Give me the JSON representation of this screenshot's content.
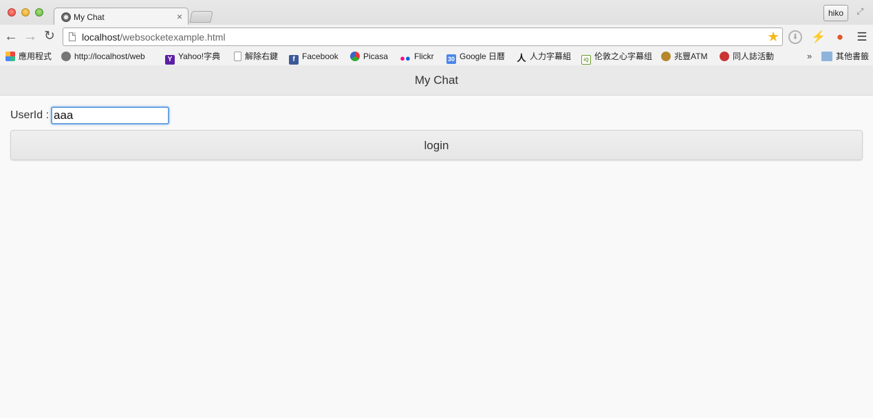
{
  "browser": {
    "tab_title": "My Chat",
    "tab_close": "×",
    "profile_name": "hiko",
    "url_host": "localhost",
    "url_path": "/websocketexample.html"
  },
  "bookmarks": [
    {
      "label": "應用程式",
      "icon": "apps-grid-icon",
      "color": "#e44"
    },
    {
      "label": "http://localhost/web",
      "icon": "globe-icon",
      "color": "#666"
    },
    {
      "label": "Yahoo!字典",
      "icon": "yahoo-icon",
      "color": "#5c1fa6",
      "glyph": "Y"
    },
    {
      "label": "解除右鍵",
      "icon": "page-icon",
      "color": "#ddd"
    },
    {
      "label": "Facebook",
      "icon": "facebook-icon",
      "color": "#3b5998",
      "glyph": "f"
    },
    {
      "label": "Picasa",
      "icon": "picasa-icon",
      "color": "#e33"
    },
    {
      "label": "Flickr",
      "icon": "flickr-icon",
      "color": "#ff0084"
    },
    {
      "label": "Google 日曆",
      "icon": "calendar-icon",
      "color": "#4a86e8",
      "glyph": "30"
    },
    {
      "label": "人力字幕組",
      "icon": "person-icon",
      "color": "#111",
      "glyph": "人"
    },
    {
      "label": "伦敦之心字幕组",
      "icon": "iqiyi-icon",
      "color": "#6a9b2a"
    },
    {
      "label": "兆豐ATM",
      "icon": "bank-icon",
      "color": "#b5872a"
    },
    {
      "label": "同人誌活動",
      "icon": "character-icon",
      "color": "#c33"
    }
  ],
  "bookmarks_more": "»",
  "other_bookmarks": "其他書籤",
  "page": {
    "title": "My Chat",
    "userid_label": "UserId :",
    "userid_value": "aaa",
    "login_label": "login"
  },
  "colors": {
    "header_bg": "#e9e9e9",
    "page_bg": "#f9f9f9",
    "input_focus": "#6aa3e0",
    "star": "#f6b81c"
  }
}
